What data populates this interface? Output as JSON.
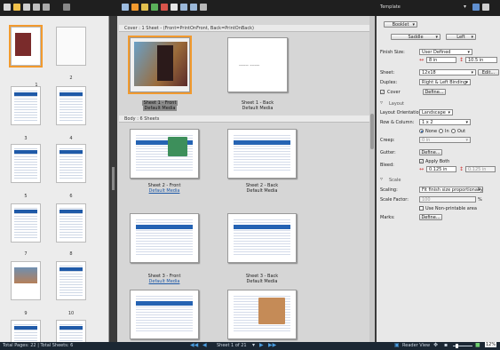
{
  "app": {
    "side_title": "Template"
  },
  "side": {
    "template_type": "Booklet",
    "binding": "Saddle",
    "binding_side": "Left",
    "finish_size_label": "Finish Size:",
    "finish_size_value": "User Defined",
    "finish_w": "8 in",
    "finish_h": "10.5 in",
    "sheet_label": "Sheet:",
    "sheet_value": "12x18",
    "edit_label": "Edit...",
    "duplex_label": "Duplex:",
    "duplex_value": "Right & Left Binding",
    "cover_label": "Cover",
    "define_label": "Define...",
    "layout_head": "Layout",
    "orientation_label": "Layout Orientation:",
    "orientation_value": "Landscape",
    "rowcol_label": "Row & Column:",
    "rowcol_value": "1 x 2",
    "none_label": "None",
    "in_label": "In",
    "out_label": "Out",
    "creep_label": "Creep:",
    "creep_value": "0 in",
    "gutter_label": "Gutter:",
    "bleed_label": "Bleed:",
    "apply_both_label": "Apply Both",
    "bleed_a": "0.125 in",
    "bleed_b": "0.125 in",
    "scale_head": "Scale",
    "scaling_label": "Scaling:",
    "scaling_value": "Fit finish size proportionally",
    "scale_factor_label": "Scale Factor:",
    "scale_factor_value": "100",
    "pct": "%",
    "nonprint_label": "Use Non-printable area",
    "marks_label": "Marks:"
  },
  "main": {
    "cover_head": "Cover : 1 Sheet - (Front=PrintOnFront, Back=PrintOnBack)",
    "body_head": "Body : 6 Sheets",
    "pages": [
      {
        "title": "Sheet 1 - Front",
        "media": "Default Media"
      },
      {
        "title": "Sheet 1 - Back",
        "media": "Default Media"
      },
      {
        "title": "Sheet 2 - Front",
        "media": "Default Media"
      },
      {
        "title": "Sheet 2 - Back",
        "media": "Default Media"
      },
      {
        "title": "Sheet 3 - Front",
        "media": "Default Media"
      },
      {
        "title": "Sheet 3 - Back",
        "media": "Default Media"
      }
    ],
    "cover_dashes": "------ ------"
  },
  "thumbs": {
    "labels": [
      "1",
      "2",
      "3",
      "4",
      "5",
      "6",
      "7",
      "8",
      "9",
      "10"
    ]
  },
  "status": {
    "pages": "Total Pages: 22 | Total Sheets: 6",
    "sheet_nav": "Sheet 1 of 21",
    "reader_view": "Reader View",
    "zoom": "12%"
  },
  "colors": {
    "accent": "#f29a2e",
    "brand_blue": "#1f5aa8",
    "topbar": "#1f1f1f",
    "status_bg": "#1b2733"
  }
}
